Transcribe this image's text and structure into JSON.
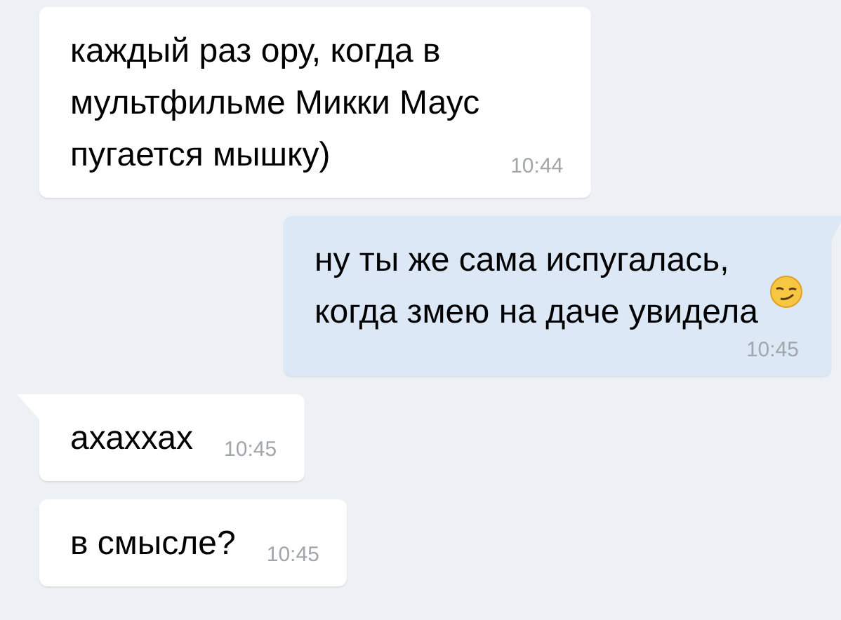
{
  "messages": [
    {
      "kind": "incoming",
      "tail": false,
      "text": "каждый раз ору, когда в\nмультфильме Микки Маус\nпугается мышку)",
      "time": "10:44",
      "time_below": false,
      "emoji": false
    },
    {
      "kind": "outgoing",
      "tail": true,
      "text": "ну ты же сама испугалась,\nкогда змею на даче увидела",
      "time": "10:45",
      "time_below": true,
      "emoji": true
    },
    {
      "kind": "incoming",
      "tail": true,
      "text": "ахаххах",
      "time": "10:45",
      "time_below": false,
      "emoji": false
    },
    {
      "kind": "incoming",
      "tail": false,
      "text": "в смысле?",
      "time": "10:45",
      "time_below": false,
      "emoji": false
    }
  ]
}
